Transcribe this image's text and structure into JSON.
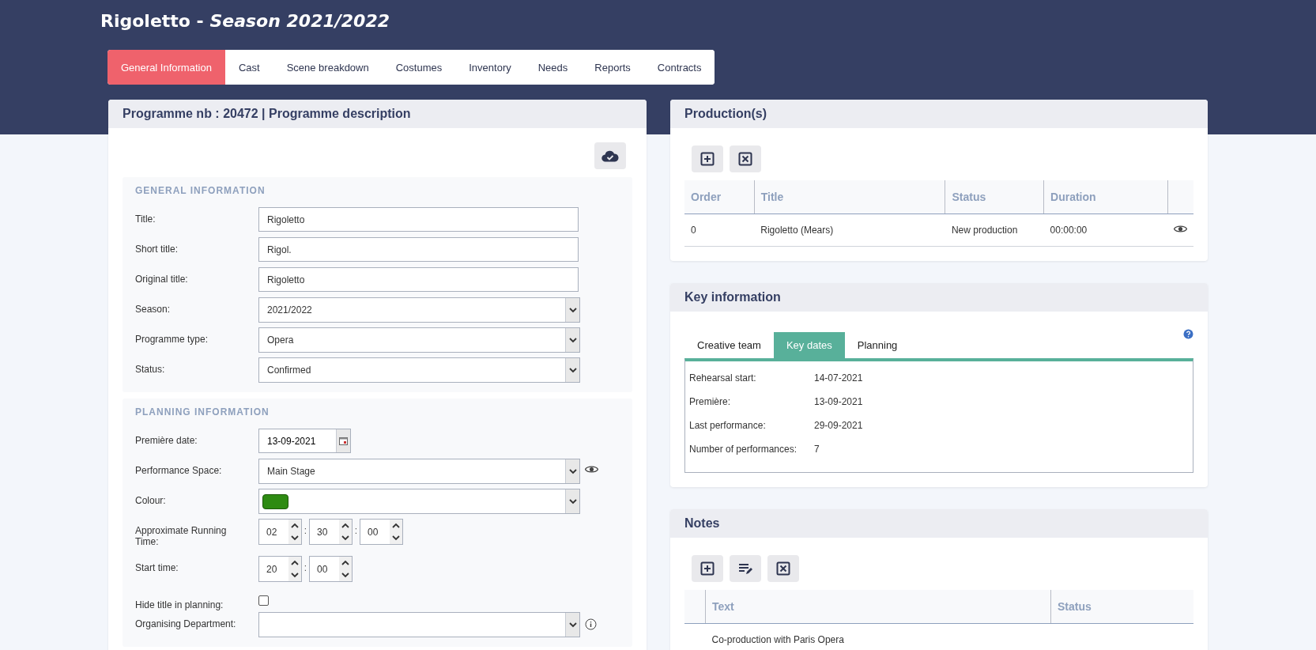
{
  "page_title": {
    "name": "Rigoletto - ",
    "season": "Season 2021/2022"
  },
  "tabs": [
    {
      "label": "General Information",
      "selected": true
    },
    {
      "label": "Cast",
      "selected": false
    },
    {
      "label": "Scene breakdown",
      "selected": false
    },
    {
      "label": "Costumes",
      "selected": false
    },
    {
      "label": "Inventory",
      "selected": false
    },
    {
      "label": "Needs",
      "selected": false
    },
    {
      "label": "Reports",
      "selected": false
    },
    {
      "label": "Contracts",
      "selected": false
    }
  ],
  "programme_panel": {
    "title": "Programme nb : 20472 | Programme description",
    "sections": [
      {
        "heading": "GENERAL INFORMATION",
        "fields": [
          {
            "kind": "text",
            "label": "Title:",
            "value": "Rigoletto"
          },
          {
            "kind": "text",
            "label": "Short title:",
            "value": "Rigol."
          },
          {
            "kind": "text",
            "label": "Original title:",
            "value": "Rigoletto"
          },
          {
            "kind": "select",
            "label": "Season:",
            "value": "2021/2022"
          },
          {
            "kind": "select",
            "label": "Programme type:",
            "value": "Opera"
          },
          {
            "kind": "select",
            "label": "Status:",
            "value": "Confirmed"
          }
        ]
      },
      {
        "heading": "PLANNING INFORMATION",
        "fields": [
          {
            "kind": "date",
            "label": "Première date:",
            "value": "13-09-2021"
          },
          {
            "kind": "select",
            "label": "Performance Space:",
            "value": "Main Stage",
            "view_icon": true
          },
          {
            "kind": "colour",
            "label": "Colour:",
            "color": "#2e8b12"
          },
          {
            "kind": "time",
            "label": "Approximate Running Time:",
            "parts": [
              "02",
              "30",
              "00"
            ],
            "separator": ":"
          },
          {
            "kind": "time",
            "label": "Start time:",
            "parts": [
              "20",
              "00"
            ],
            "separator": ":"
          },
          {
            "kind": "checkbox",
            "label": "Hide title in planning:",
            "checked": false
          },
          {
            "kind": "select",
            "label": "Organising Department:",
            "info_icon": true
          }
        ]
      }
    ]
  },
  "productions": {
    "title": "Production(s)",
    "columns": [
      "Order",
      "Title",
      "Status",
      "Duration"
    ],
    "rows": [
      {
        "cells": [
          "0",
          "Rigoletto (Mears)",
          "New production",
          "00:00:00"
        ]
      }
    ]
  },
  "key_information": {
    "title": "Key information",
    "tabs": [
      {
        "label": "Creative team",
        "selected": false
      },
      {
        "label": "Key dates",
        "selected": true
      },
      {
        "label": "Planning",
        "selected": false
      }
    ],
    "items": [
      {
        "label": "Rehearsal start:",
        "value": "14-07-2021"
      },
      {
        "label": "Première:",
        "value": "13-09-2021"
      },
      {
        "label": "Last performance:",
        "value": "29-09-2021"
      },
      {
        "label": "Number of performances:",
        "value": "7"
      }
    ]
  },
  "notes": {
    "title": "Notes",
    "columns": [
      "Text",
      "Status"
    ],
    "rows": [
      {
        "text": "Co-production with Paris Opera"
      }
    ]
  }
}
